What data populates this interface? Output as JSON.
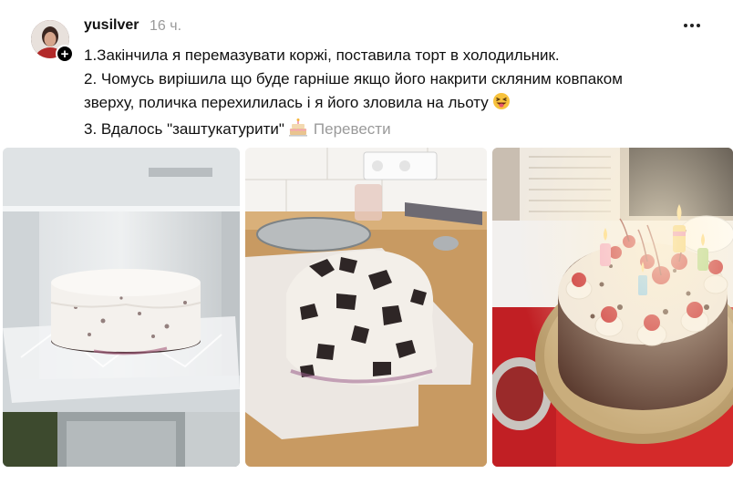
{
  "post": {
    "username": "yusilver",
    "time": "16 ч.",
    "lines": [
      "1.Закінчила я перемазувати коржі, поставила торт в холодильник.",
      "2. Чомусь вирішила що буде гарніше якщо його накрити скляним ковпаком",
      "зверху, поличка перехилилась і я його зловила на льоту",
      "3. Вдалось \"заштукатурити\""
    ],
    "translate_label": "Перевести",
    "emoji_line2": "squinting-tongue-emoji",
    "emoji_line3": "birthday-cake-emoji"
  },
  "icons": {
    "follow": "plus-icon",
    "more": "more-dots-icon"
  },
  "gallery": {
    "photos": [
      "fridge-cake-photo",
      "broken-cake-photo",
      "decorated-cake-photo"
    ]
  }
}
